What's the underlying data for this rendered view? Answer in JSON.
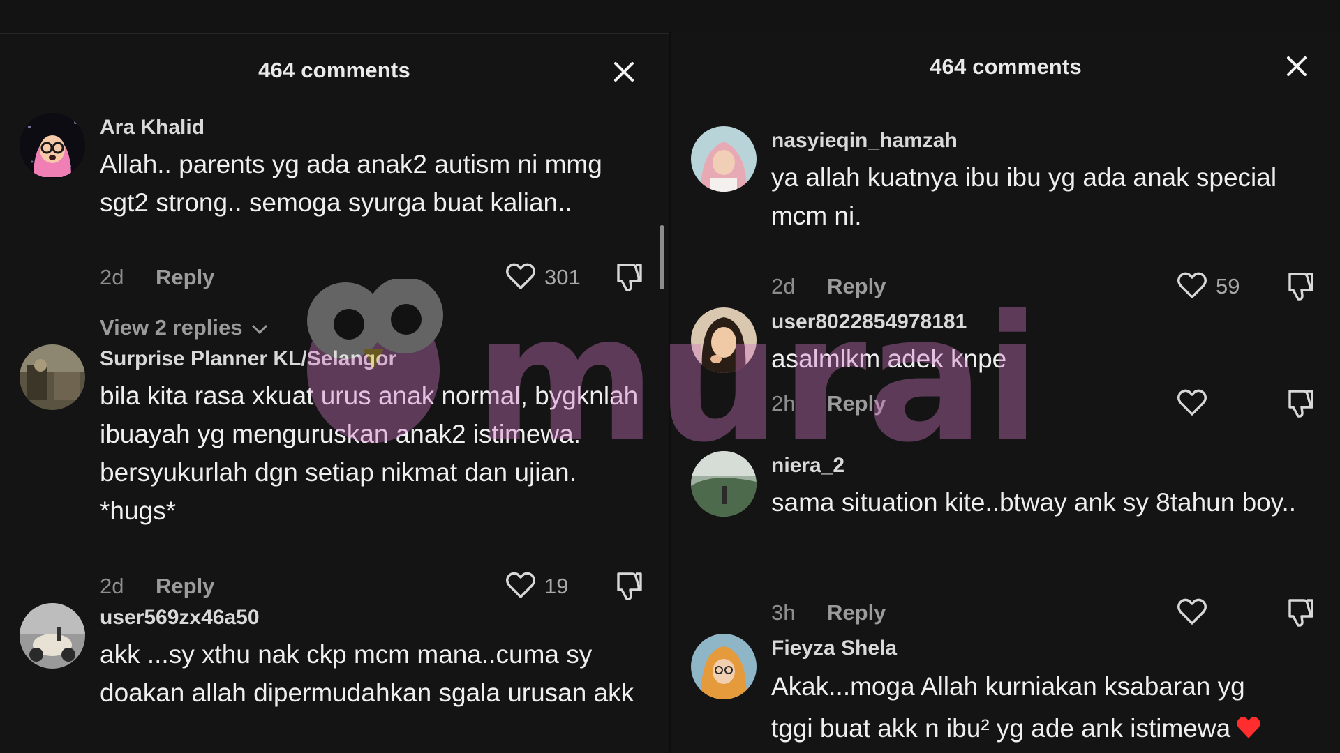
{
  "left_panel": {
    "title": "464 comments",
    "comments": [
      {
        "username": "Ara Khalid",
        "text": "Allah.. parents yg ada anak2 autism ni mmg sgt2 strong.. semoga syurga buat kalian..",
        "time": "2d",
        "reply_label": "Reply",
        "likes": "301",
        "view_replies": "View 2 replies"
      },
      {
        "username": "Surprise Planner KL/Selangor",
        "text": "bila kita rasa xkuat urus anak normal, bygknlah ibuayah yg menguruskan anak2 istimewa. bersyukurlah dgn setiap nikmat dan ujian. *hugs*",
        "time": "2d",
        "reply_label": "Reply",
        "likes": "19"
      },
      {
        "username": "user569zx46a50",
        "text": "akk ...sy xthu nak ckp mcm mana..cuma sy doakan allah dipermudahkan sgala urusan akk"
      }
    ]
  },
  "right_panel": {
    "title": "464 comments",
    "comments": [
      {
        "username": "nasyieqin_hamzah",
        "text": "ya allah kuatnya ibu ibu yg ada anak special mcm ni.",
        "time": "2d",
        "reply_label": "Reply",
        "likes": "59"
      },
      {
        "username": "user8022854978181",
        "text": "asalmlkm adek knpe",
        "time": "2h",
        "reply_label": "Reply"
      },
      {
        "username": "niera_2",
        "text": "sama situation kite..btway ank sy 8tahun boy..",
        "time": "3h",
        "reply_label": "Reply"
      },
      {
        "username": "Fieyza Shela",
        "text_line1": "Akak...moga Allah kurniakan ksabaran yg",
        "text_line2": "tggi buat akk n ibu² yg ade ank istimewa",
        "emoji": "❤️"
      }
    ]
  },
  "watermark": {
    "text": "murai"
  },
  "colors": {
    "background": "#141414",
    "text": "#efefef",
    "muted": "#8d8d8d",
    "heart": "#ff2d2d"
  },
  "icons": [
    "close-icon",
    "heart-outline-icon",
    "thumbs-down-icon",
    "chevron-down-icon",
    "red-heart-emoji"
  ]
}
